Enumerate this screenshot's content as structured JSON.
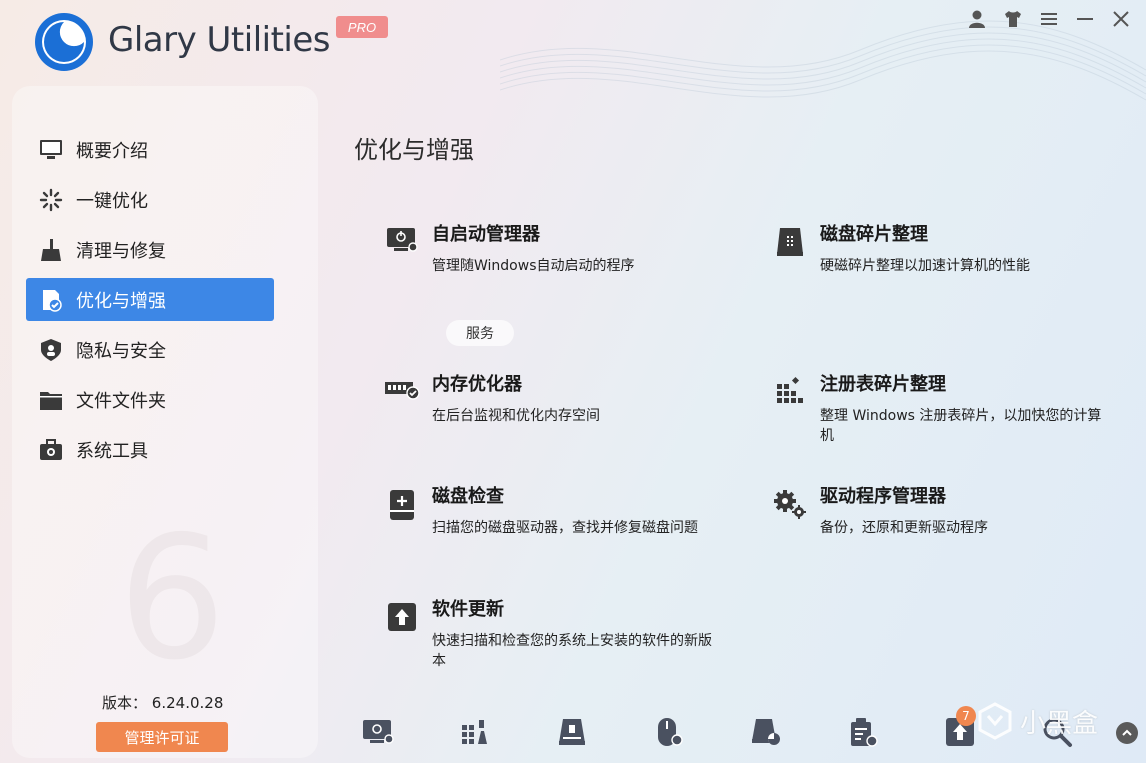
{
  "header": {
    "app_title": "Glary Utilities",
    "pro_badge": "PRO",
    "window_controls": [
      "user-icon",
      "skin-icon",
      "menu-icon",
      "minimize-icon",
      "close-icon"
    ]
  },
  "sidebar": {
    "items": [
      {
        "label": "概要介绍",
        "icon": "monitor-icon",
        "active": false
      },
      {
        "label": "一键优化",
        "icon": "sparkle-icon",
        "active": false
      },
      {
        "label": "清理与修复",
        "icon": "broom-icon",
        "active": false
      },
      {
        "label": "优化与增强",
        "icon": "optimize-icon",
        "active": true
      },
      {
        "label": "隐私与安全",
        "icon": "shield-icon",
        "active": false
      },
      {
        "label": "文件文件夹",
        "icon": "folder-icon",
        "active": false
      },
      {
        "label": "系统工具",
        "icon": "toolbox-icon",
        "active": false
      }
    ],
    "version_label": "版本：",
    "version_value": "6.24.0.28",
    "license_button": "管理许可证",
    "watermark": "6"
  },
  "main": {
    "title": "优化与增强",
    "service_pill": "服务",
    "tools": [
      {
        "name": "自启动管理器",
        "desc": "管理随Windows自动启动的程序",
        "icon": "startup-manager-icon"
      },
      {
        "name": "磁盘碎片整理",
        "desc": "硬磁碎片整理以加速计算机的性能",
        "icon": "disk-defrag-icon"
      },
      {
        "name": "内存优化器",
        "desc": "在后台监视和优化内存空间",
        "icon": "memory-optimizer-icon"
      },
      {
        "name": "注册表碎片整理",
        "desc": "整理 Windows 注册表碎片，以加快您的计算机",
        "icon": "registry-defrag-icon"
      },
      {
        "name": "磁盘检查",
        "desc": "扫描您的磁盘驱动器，查找并修复磁盘问题",
        "icon": "disk-check-icon"
      },
      {
        "name": "驱动程序管理器",
        "desc": "备份，还原和更新驱动程序",
        "icon": "driver-manager-icon"
      },
      {
        "name": "软件更新",
        "desc": "快速扫描和检查您的系统上安装的软件的新版本",
        "icon": "software-update-icon"
      }
    ]
  },
  "bottombar": {
    "icons": [
      "startup-manager-icon",
      "registry-icon",
      "disk-cleaner-icon",
      "mouse-icon",
      "disk-analysis-icon",
      "process-icon",
      "update-icon",
      "search-icon"
    ],
    "update_badge": "7"
  },
  "watermark_brand": "小黑盒",
  "colors": {
    "accent": "#3d87e6",
    "license": "#f0874f",
    "pro": "#f08d8d"
  }
}
